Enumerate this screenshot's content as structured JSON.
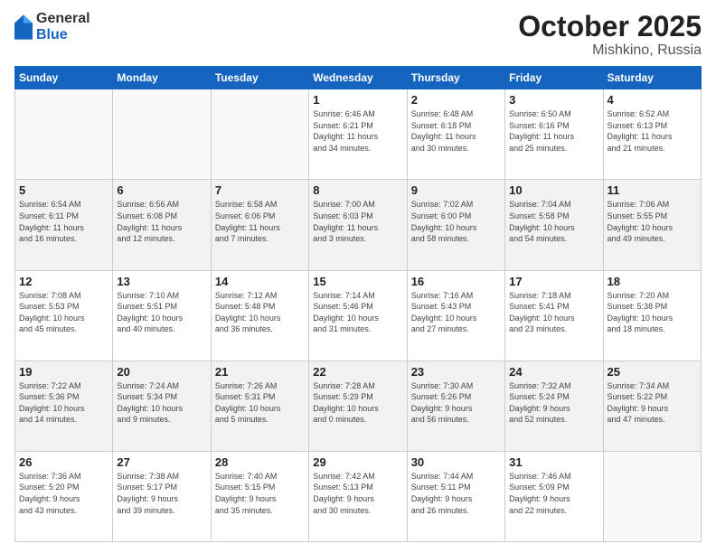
{
  "header": {
    "logo_general": "General",
    "logo_blue": "Blue",
    "month": "October 2025",
    "location": "Mishkino, Russia"
  },
  "days_of_week": [
    "Sunday",
    "Monday",
    "Tuesday",
    "Wednesday",
    "Thursday",
    "Friday",
    "Saturday"
  ],
  "weeks": [
    [
      {
        "day": "",
        "info": ""
      },
      {
        "day": "",
        "info": ""
      },
      {
        "day": "",
        "info": ""
      },
      {
        "day": "1",
        "info": "Sunrise: 6:46 AM\nSunset: 6:21 PM\nDaylight: 11 hours\nand 34 minutes."
      },
      {
        "day": "2",
        "info": "Sunrise: 6:48 AM\nSunset: 6:18 PM\nDaylight: 11 hours\nand 30 minutes."
      },
      {
        "day": "3",
        "info": "Sunrise: 6:50 AM\nSunset: 6:16 PM\nDaylight: 11 hours\nand 25 minutes."
      },
      {
        "day": "4",
        "info": "Sunrise: 6:52 AM\nSunset: 6:13 PM\nDaylight: 11 hours\nand 21 minutes."
      }
    ],
    [
      {
        "day": "5",
        "info": "Sunrise: 6:54 AM\nSunset: 6:11 PM\nDaylight: 11 hours\nand 16 minutes."
      },
      {
        "day": "6",
        "info": "Sunrise: 6:56 AM\nSunset: 6:08 PM\nDaylight: 11 hours\nand 12 minutes."
      },
      {
        "day": "7",
        "info": "Sunrise: 6:58 AM\nSunset: 6:06 PM\nDaylight: 11 hours\nand 7 minutes."
      },
      {
        "day": "8",
        "info": "Sunrise: 7:00 AM\nSunset: 6:03 PM\nDaylight: 11 hours\nand 3 minutes."
      },
      {
        "day": "9",
        "info": "Sunrise: 7:02 AM\nSunset: 6:00 PM\nDaylight: 10 hours\nand 58 minutes."
      },
      {
        "day": "10",
        "info": "Sunrise: 7:04 AM\nSunset: 5:58 PM\nDaylight: 10 hours\nand 54 minutes."
      },
      {
        "day": "11",
        "info": "Sunrise: 7:06 AM\nSunset: 5:55 PM\nDaylight: 10 hours\nand 49 minutes."
      }
    ],
    [
      {
        "day": "12",
        "info": "Sunrise: 7:08 AM\nSunset: 5:53 PM\nDaylight: 10 hours\nand 45 minutes."
      },
      {
        "day": "13",
        "info": "Sunrise: 7:10 AM\nSunset: 5:51 PM\nDaylight: 10 hours\nand 40 minutes."
      },
      {
        "day": "14",
        "info": "Sunrise: 7:12 AM\nSunset: 5:48 PM\nDaylight: 10 hours\nand 36 minutes."
      },
      {
        "day": "15",
        "info": "Sunrise: 7:14 AM\nSunset: 5:46 PM\nDaylight: 10 hours\nand 31 minutes."
      },
      {
        "day": "16",
        "info": "Sunrise: 7:16 AM\nSunset: 5:43 PM\nDaylight: 10 hours\nand 27 minutes."
      },
      {
        "day": "17",
        "info": "Sunrise: 7:18 AM\nSunset: 5:41 PM\nDaylight: 10 hours\nand 23 minutes."
      },
      {
        "day": "18",
        "info": "Sunrise: 7:20 AM\nSunset: 5:38 PM\nDaylight: 10 hours\nand 18 minutes."
      }
    ],
    [
      {
        "day": "19",
        "info": "Sunrise: 7:22 AM\nSunset: 5:36 PM\nDaylight: 10 hours\nand 14 minutes."
      },
      {
        "day": "20",
        "info": "Sunrise: 7:24 AM\nSunset: 5:34 PM\nDaylight: 10 hours\nand 9 minutes."
      },
      {
        "day": "21",
        "info": "Sunrise: 7:26 AM\nSunset: 5:31 PM\nDaylight: 10 hours\nand 5 minutes."
      },
      {
        "day": "22",
        "info": "Sunrise: 7:28 AM\nSunset: 5:29 PM\nDaylight: 10 hours\nand 0 minutes."
      },
      {
        "day": "23",
        "info": "Sunrise: 7:30 AM\nSunset: 5:26 PM\nDaylight: 9 hours\nand 56 minutes."
      },
      {
        "day": "24",
        "info": "Sunrise: 7:32 AM\nSunset: 5:24 PM\nDaylight: 9 hours\nand 52 minutes."
      },
      {
        "day": "25",
        "info": "Sunrise: 7:34 AM\nSunset: 5:22 PM\nDaylight: 9 hours\nand 47 minutes."
      }
    ],
    [
      {
        "day": "26",
        "info": "Sunrise: 7:36 AM\nSunset: 5:20 PM\nDaylight: 9 hours\nand 43 minutes."
      },
      {
        "day": "27",
        "info": "Sunrise: 7:38 AM\nSunset: 5:17 PM\nDaylight: 9 hours\nand 39 minutes."
      },
      {
        "day": "28",
        "info": "Sunrise: 7:40 AM\nSunset: 5:15 PM\nDaylight: 9 hours\nand 35 minutes."
      },
      {
        "day": "29",
        "info": "Sunrise: 7:42 AM\nSunset: 5:13 PM\nDaylight: 9 hours\nand 30 minutes."
      },
      {
        "day": "30",
        "info": "Sunrise: 7:44 AM\nSunset: 5:11 PM\nDaylight: 9 hours\nand 26 minutes."
      },
      {
        "day": "31",
        "info": "Sunrise: 7:46 AM\nSunset: 5:09 PM\nDaylight: 9 hours\nand 22 minutes."
      },
      {
        "day": "",
        "info": ""
      }
    ]
  ]
}
